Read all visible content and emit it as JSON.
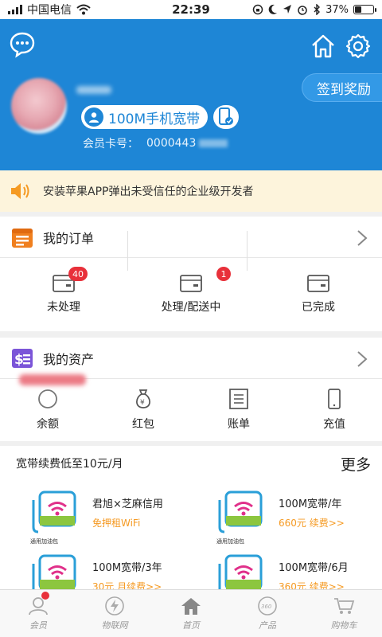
{
  "status_bar": {
    "carrier": "中国电信",
    "time": "22:39",
    "battery_text": "37%",
    "battery_level": 0.37
  },
  "header": {
    "membership_badge": "100M手机宽带",
    "member_card_label": "会员卡号：",
    "member_card_number": "0000443",
    "signin_button": "签到奖励"
  },
  "notice": {
    "text": "安装苹果APP弹出未受信任的企业级开发者"
  },
  "orders": {
    "title": "我的订单",
    "items": [
      {
        "label": "未处理",
        "badge": "40"
      },
      {
        "label": "处理/配送中",
        "badge": "1"
      },
      {
        "label": "已完成",
        "badge": ""
      }
    ]
  },
  "assets": {
    "title": "我的资产",
    "items": [
      {
        "label": "余额"
      },
      {
        "label": "红包"
      },
      {
        "label": "账单"
      },
      {
        "label": "充值"
      }
    ]
  },
  "promo": {
    "title": "宽带续费低至10元/月",
    "more": "更多",
    "caption": "通用加油包",
    "items": [
      {
        "title": "君旭×芝麻信用",
        "subtitle": "免押租WiFi"
      },
      {
        "title": "100M宽带/年",
        "subtitle": "660元 续费>>"
      },
      {
        "title": "100M宽带/3年",
        "subtitle": "30元 月续费>>"
      },
      {
        "title": "100M宽带/6月",
        "subtitle": "360元 续费>>"
      }
    ]
  },
  "tabbar": {
    "items": [
      {
        "label": "会员"
      },
      {
        "label": "物联网"
      },
      {
        "label": "首页"
      },
      {
        "label": "产品"
      },
      {
        "label": "购物车"
      }
    ]
  },
  "colors": {
    "brand_blue": "#1e86d6",
    "badge_red": "#e8303a",
    "orange": "#f59a23",
    "purple": "#7b55d8"
  }
}
